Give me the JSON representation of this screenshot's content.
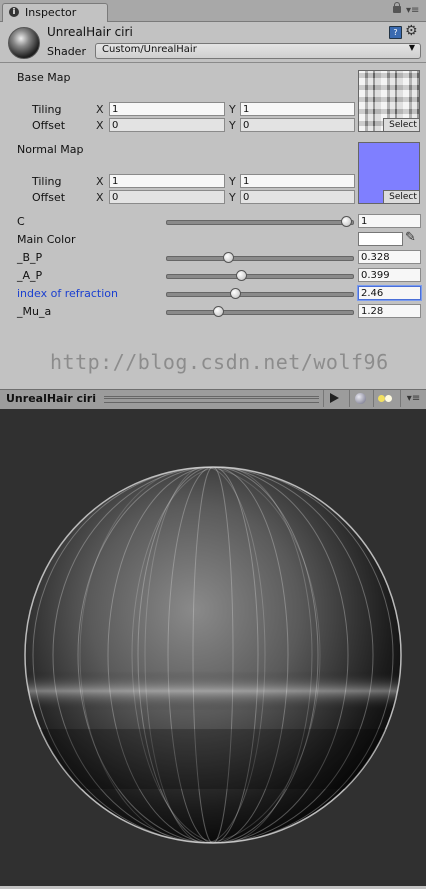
{
  "tab": {
    "label": "Inspector"
  },
  "material": {
    "name": "UnrealHair ciri",
    "shader_label": "Shader",
    "shader_value": "Custom/UnrealHair"
  },
  "base_map": {
    "label": "Base Map",
    "select": "Select",
    "tiling": {
      "label": "Tiling",
      "x_label": "X",
      "x": "1",
      "y_label": "Y",
      "y": "1"
    },
    "offset": {
      "label": "Offset",
      "x_label": "X",
      "x": "0",
      "y_label": "Y",
      "y": "0"
    }
  },
  "normal_map": {
    "label": "Normal Map",
    "select": "Select",
    "color": "#7f7fff",
    "tiling": {
      "label": "Tiling",
      "x_label": "X",
      "x": "1",
      "y_label": "Y",
      "y": "1"
    },
    "offset": {
      "label": "Offset",
      "x_label": "X",
      "x": "0",
      "y_label": "Y",
      "y": "0"
    }
  },
  "properties": {
    "c": {
      "label": "C",
      "value": "1",
      "slider": 1.0
    },
    "main_color": {
      "label": "Main Color",
      "color": "#ffffff"
    },
    "b_p": {
      "label": "_B_P",
      "value": "0.328",
      "slider": 0.328
    },
    "a_p": {
      "label": "_A_P",
      "value": "0.399",
      "slider": 0.399
    },
    "ior": {
      "label": "index of refraction",
      "value": "2.46",
      "slider": 0.365,
      "label_color": "#1a3fd0"
    },
    "mu_a": {
      "label": "_Mu_a",
      "value": "1.28",
      "slider": 0.27
    }
  },
  "watermark": "http://blog.csdn.net/wolf96",
  "preview": {
    "title": "UnrealHair ciri"
  }
}
